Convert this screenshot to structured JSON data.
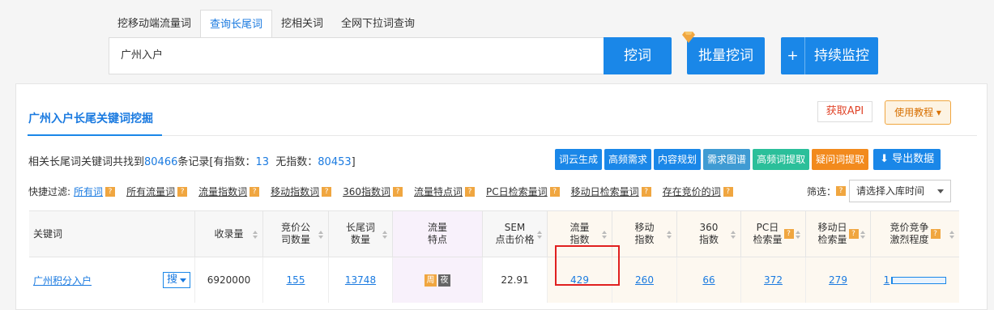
{
  "tabs": [
    {
      "label": "挖移动端流量词",
      "active": false
    },
    {
      "label": "查询长尾词",
      "active": true
    },
    {
      "label": "挖相关词",
      "active": false
    },
    {
      "label": "全网下拉词查询",
      "active": false
    }
  ],
  "search": {
    "value": "广州入户",
    "dig_label": "挖词"
  },
  "batch_label": "批量挖词",
  "monitor": {
    "plus": "+",
    "label": "持续监控"
  },
  "panel": {
    "title": "广州入户长尾关键词挖掘",
    "api_label": "获取API",
    "tutorial_label": "使用教程 ▾"
  },
  "summary": {
    "prefix": "相关长尾词关键词共找到",
    "total": "80466",
    "mid1": "条记录[有指数：",
    "with_index": "13",
    "mid2": "无指数：",
    "without_index": "80453",
    "suffix": "]"
  },
  "toolbar": [
    "词云生成",
    "高频需求",
    "内容规划",
    "需求图谱",
    "高频词提取",
    "疑问词提取"
  ],
  "export_label": "导出数据",
  "filters": {
    "label": "快捷过滤:",
    "items": [
      "所有词",
      "所有流量词",
      "流量指数词",
      "移动指数词",
      "360指数词",
      "流量特点词",
      "PC日检索量词",
      "移动日检索量词",
      "存在竞价的词"
    ],
    "screen_label": "筛选：",
    "select_placeholder": "请选择入库时间"
  },
  "table": {
    "headers": [
      "关键词",
      "收录量",
      "竞价公\n司数量",
      "长尾词\n数量",
      "流量\n特点",
      "SEM\n点击价格",
      "流量\n指数",
      "移动\n指数",
      "360\n指数",
      "PC日\n检索量",
      "移动日\n检索量",
      "竞价竞争\n激烈程度"
    ],
    "row": {
      "keyword": "广州积分入户",
      "sou": "搜",
      "indexed": "6920000",
      "bid_companies": "155",
      "longtail": "13748",
      "tag_week": "周",
      "tag_night": "夜",
      "sem_price": "22.91",
      "traffic_index": "429",
      "mobile_index": "260",
      "index_360": "66",
      "pc_daily": "372",
      "mobile_daily": "279",
      "competition": "1",
      "competition_fraction": 0.01
    }
  },
  "colors": {
    "primary": "#1a87e8",
    "highlight": "#e02020",
    "orange": "#f0a640"
  }
}
